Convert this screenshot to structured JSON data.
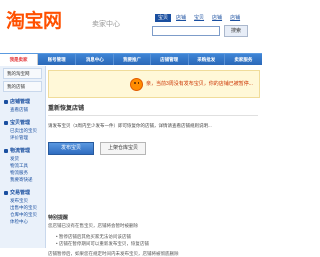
{
  "header": {
    "logo": "淘宝网",
    "subtitle": "卖家中心",
    "top_tabs": [
      "宝贝",
      "店铺",
      "宝贝",
      "店铺",
      "店铺"
    ],
    "search_button": "搜索"
  },
  "nav": {
    "items": [
      "我是卖家",
      "账号管理",
      "消息中心",
      "我要推广",
      "店铺管理",
      "采购批发",
      "卖家服务"
    ]
  },
  "sidebar": {
    "tabs": [
      "我的淘宝网",
      "我的店铺"
    ],
    "sections": [
      {
        "title": "店铺管理",
        "links": [
          "查看店铺"
        ]
      },
      {
        "title": "宝贝管理",
        "links": [
          "已卖出的宝贝",
          "评价管理"
        ]
      },
      {
        "title": "物流管理",
        "links": [
          "发货",
          "物流工具",
          "物流服务",
          "我要寄快递"
        ]
      },
      {
        "title": "交易管理",
        "links": [
          "发布宝贝",
          "出售中的宝贝",
          "仓库中的宝贝",
          "体检中心"
        ]
      }
    ]
  },
  "notice": {
    "text": "亲，当前3周没有发布宝贝，你的店铺已被暂停..."
  },
  "panel": {
    "title": "重新恢复店铺",
    "description": "请发布宝贝（3周内至少发布一件）即可恢复你的店铺，详情请查看店铺规则说明...",
    "primary_button": "发布宝贝",
    "secondary_button": "上架仓库宝贝"
  },
  "tips": {
    "title": "特别提醒",
    "line": "您店铺已没有在售宝贝，店铺将会暂时被删除",
    "bullets": [
      "暂停店铺后其他买家无法访问该店铺",
      "店铺在暂停期间可以重新发布宝贝，恢复店铺"
    ],
    "footer": "店铺暂停后，如果您在规定时间内未发布宝贝，店铺将被彻底删除"
  }
}
